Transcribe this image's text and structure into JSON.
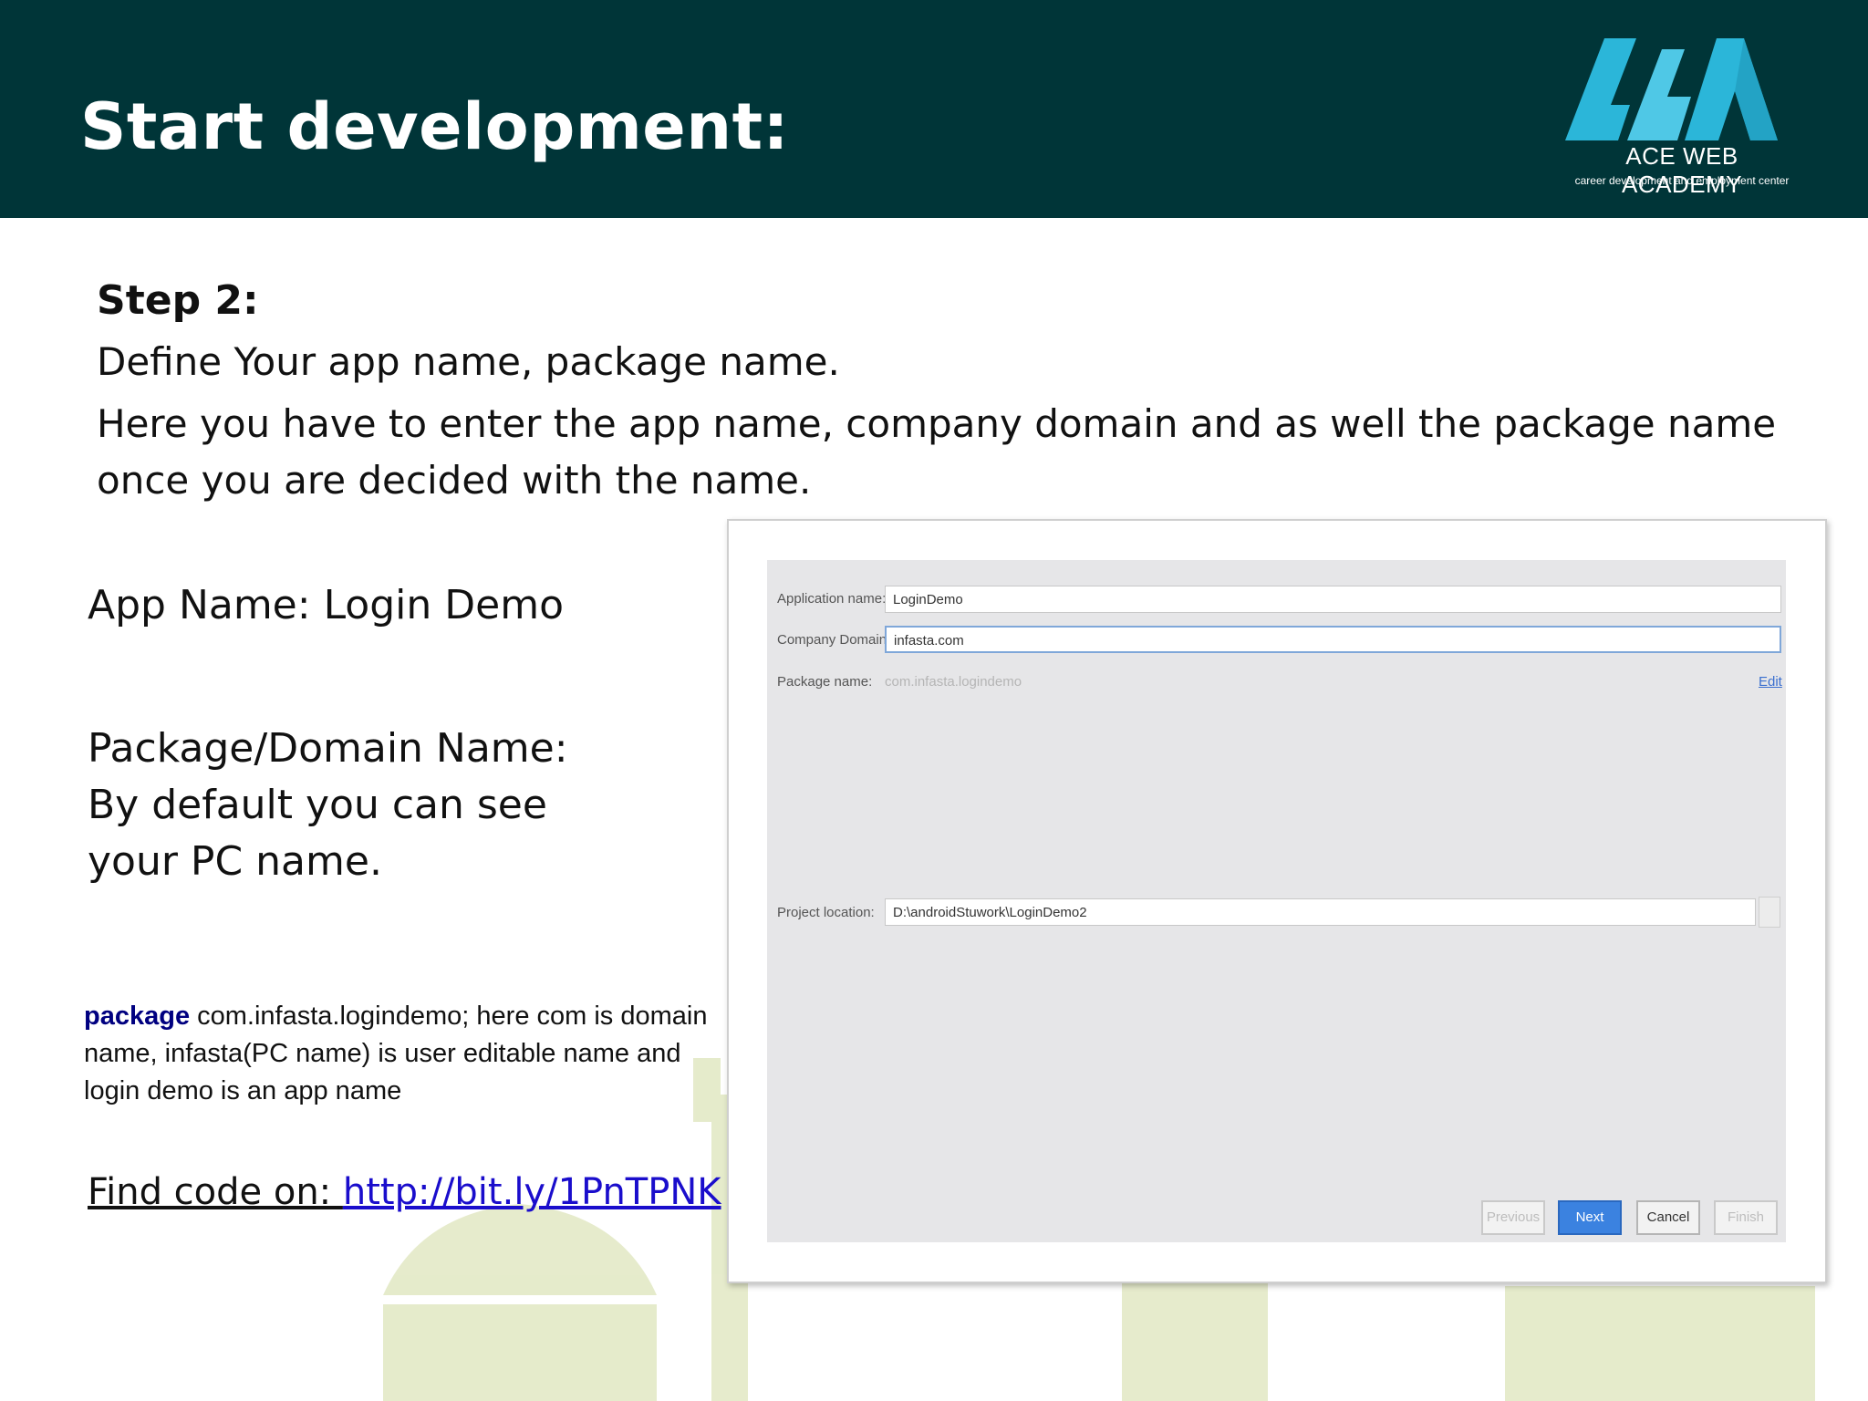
{
  "header": {
    "title": "Start development:",
    "logo": {
      "name": "ACE WEB ACADEMY",
      "tagline": "career development and employment center",
      "accent": "#2bb6d9"
    },
    "background": "#003538"
  },
  "content": {
    "step": "Step 2:",
    "define": "Define Your app name, package name.",
    "here": "Here you have to enter the app name, company domain and as well the package name once you are decided with the name.",
    "app_name": "App Name: Login Demo",
    "package_title": "Package/Domain Name:",
    "package_line2": "By default you can see",
    "package_line3": "your PC name.",
    "package_keyword": "package",
    "package_desc": " com.infasta.logindemo; here com is domain name, infasta(PC name) is user editable name and login demo is an app name",
    "find_prefix": "Find code on: ",
    "find_link": "http://bit.ly/1PnTPNK"
  },
  "dialog": {
    "application_name_label": "Application name:",
    "application_name_value": "LoginDemo",
    "company_domain_label": "Company Domain:",
    "company_domain_value": "infasta.com",
    "package_name_label": "Package name:",
    "package_name_value": "com.infasta.logindemo",
    "edit_label": "Edit",
    "project_location_label": "Project location:",
    "project_location_value": "D:\\androidStuwork\\LoginDemo2",
    "buttons": {
      "previous": "Previous",
      "next": "Next",
      "cancel": "Cancel",
      "finish": "Finish"
    }
  }
}
